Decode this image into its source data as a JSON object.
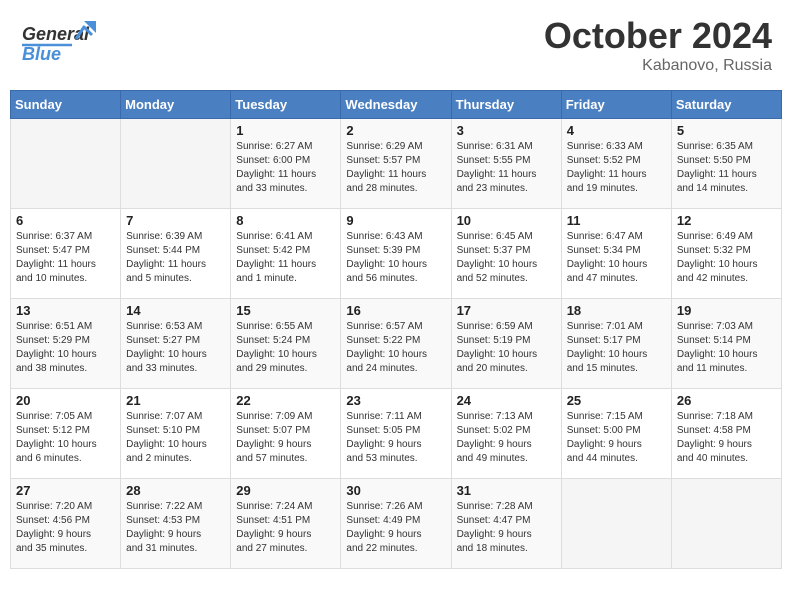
{
  "header": {
    "logo_general": "General",
    "logo_blue": "Blue",
    "month_title": "October 2024",
    "location": "Kabanovo, Russia"
  },
  "calendar": {
    "days_of_week": [
      "Sunday",
      "Monday",
      "Tuesday",
      "Wednesday",
      "Thursday",
      "Friday",
      "Saturday"
    ],
    "weeks": [
      {
        "days": [
          {
            "num": "",
            "info": ""
          },
          {
            "num": "",
            "info": ""
          },
          {
            "num": "1",
            "info": "Sunrise: 6:27 AM\nSunset: 6:00 PM\nDaylight: 11 hours\nand 33 minutes."
          },
          {
            "num": "2",
            "info": "Sunrise: 6:29 AM\nSunset: 5:57 PM\nDaylight: 11 hours\nand 28 minutes."
          },
          {
            "num": "3",
            "info": "Sunrise: 6:31 AM\nSunset: 5:55 PM\nDaylight: 11 hours\nand 23 minutes."
          },
          {
            "num": "4",
            "info": "Sunrise: 6:33 AM\nSunset: 5:52 PM\nDaylight: 11 hours\nand 19 minutes."
          },
          {
            "num": "5",
            "info": "Sunrise: 6:35 AM\nSunset: 5:50 PM\nDaylight: 11 hours\nand 14 minutes."
          }
        ]
      },
      {
        "days": [
          {
            "num": "6",
            "info": "Sunrise: 6:37 AM\nSunset: 5:47 PM\nDaylight: 11 hours\nand 10 minutes."
          },
          {
            "num": "7",
            "info": "Sunrise: 6:39 AM\nSunset: 5:44 PM\nDaylight: 11 hours\nand 5 minutes."
          },
          {
            "num": "8",
            "info": "Sunrise: 6:41 AM\nSunset: 5:42 PM\nDaylight: 11 hours\nand 1 minute."
          },
          {
            "num": "9",
            "info": "Sunrise: 6:43 AM\nSunset: 5:39 PM\nDaylight: 10 hours\nand 56 minutes."
          },
          {
            "num": "10",
            "info": "Sunrise: 6:45 AM\nSunset: 5:37 PM\nDaylight: 10 hours\nand 52 minutes."
          },
          {
            "num": "11",
            "info": "Sunrise: 6:47 AM\nSunset: 5:34 PM\nDaylight: 10 hours\nand 47 minutes."
          },
          {
            "num": "12",
            "info": "Sunrise: 6:49 AM\nSunset: 5:32 PM\nDaylight: 10 hours\nand 42 minutes."
          }
        ]
      },
      {
        "days": [
          {
            "num": "13",
            "info": "Sunrise: 6:51 AM\nSunset: 5:29 PM\nDaylight: 10 hours\nand 38 minutes."
          },
          {
            "num": "14",
            "info": "Sunrise: 6:53 AM\nSunset: 5:27 PM\nDaylight: 10 hours\nand 33 minutes."
          },
          {
            "num": "15",
            "info": "Sunrise: 6:55 AM\nSunset: 5:24 PM\nDaylight: 10 hours\nand 29 minutes."
          },
          {
            "num": "16",
            "info": "Sunrise: 6:57 AM\nSunset: 5:22 PM\nDaylight: 10 hours\nand 24 minutes."
          },
          {
            "num": "17",
            "info": "Sunrise: 6:59 AM\nSunset: 5:19 PM\nDaylight: 10 hours\nand 20 minutes."
          },
          {
            "num": "18",
            "info": "Sunrise: 7:01 AM\nSunset: 5:17 PM\nDaylight: 10 hours\nand 15 minutes."
          },
          {
            "num": "19",
            "info": "Sunrise: 7:03 AM\nSunset: 5:14 PM\nDaylight: 10 hours\nand 11 minutes."
          }
        ]
      },
      {
        "days": [
          {
            "num": "20",
            "info": "Sunrise: 7:05 AM\nSunset: 5:12 PM\nDaylight: 10 hours\nand 6 minutes."
          },
          {
            "num": "21",
            "info": "Sunrise: 7:07 AM\nSunset: 5:10 PM\nDaylight: 10 hours\nand 2 minutes."
          },
          {
            "num": "22",
            "info": "Sunrise: 7:09 AM\nSunset: 5:07 PM\nDaylight: 9 hours\nand 57 minutes."
          },
          {
            "num": "23",
            "info": "Sunrise: 7:11 AM\nSunset: 5:05 PM\nDaylight: 9 hours\nand 53 minutes."
          },
          {
            "num": "24",
            "info": "Sunrise: 7:13 AM\nSunset: 5:02 PM\nDaylight: 9 hours\nand 49 minutes."
          },
          {
            "num": "25",
            "info": "Sunrise: 7:15 AM\nSunset: 5:00 PM\nDaylight: 9 hours\nand 44 minutes."
          },
          {
            "num": "26",
            "info": "Sunrise: 7:18 AM\nSunset: 4:58 PM\nDaylight: 9 hours\nand 40 minutes."
          }
        ]
      },
      {
        "days": [
          {
            "num": "27",
            "info": "Sunrise: 7:20 AM\nSunset: 4:56 PM\nDaylight: 9 hours\nand 35 minutes."
          },
          {
            "num": "28",
            "info": "Sunrise: 7:22 AM\nSunset: 4:53 PM\nDaylight: 9 hours\nand 31 minutes."
          },
          {
            "num": "29",
            "info": "Sunrise: 7:24 AM\nSunset: 4:51 PM\nDaylight: 9 hours\nand 27 minutes."
          },
          {
            "num": "30",
            "info": "Sunrise: 7:26 AM\nSunset: 4:49 PM\nDaylight: 9 hours\nand 22 minutes."
          },
          {
            "num": "31",
            "info": "Sunrise: 7:28 AM\nSunset: 4:47 PM\nDaylight: 9 hours\nand 18 minutes."
          },
          {
            "num": "",
            "info": ""
          },
          {
            "num": "",
            "info": ""
          }
        ]
      }
    ]
  }
}
